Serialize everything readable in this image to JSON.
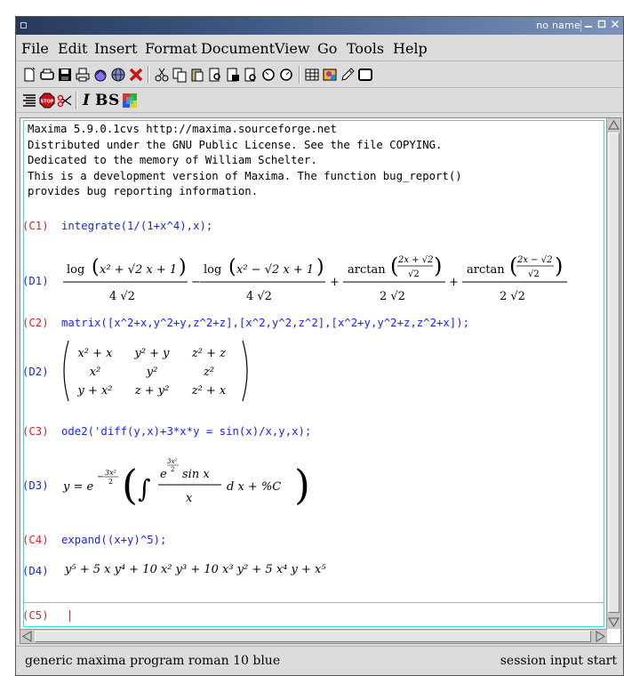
{
  "window": {
    "title": "no name",
    "controls": {
      "minimize": "‗",
      "maximize": "□",
      "close": "✕"
    }
  },
  "menu": [
    "File",
    "Edit",
    "Insert",
    "Format",
    "Document",
    "View",
    "Go",
    "Tools",
    "Help"
  ],
  "toolbar_icons": [
    "new-file-icon",
    "print-preview-icon",
    "save-icon",
    "print-icon",
    "home-icon",
    "globe-icon",
    "stop-x-icon",
    "cut-icon",
    "copy-icon",
    "paste-icon",
    "find-icon",
    "replace-icon",
    "find-next-icon",
    "undo-icon",
    "redo-icon",
    "table-icon",
    "image-icon",
    "pencil-icon",
    "frame-icon"
  ],
  "format_toolbar": {
    "icons": [
      "paragraph-align-icon",
      "stop-sign-icon",
      "scissors-icon"
    ],
    "italic": "I",
    "bold": "B",
    "strike": "S",
    "color_icon": "color-palette-icon"
  },
  "session": {
    "banner": [
      "Maxima 5.9.0.1cvs http://maxima.sourceforge.net",
      "Distributed under the GNU Public License. See the file COPYING.",
      "Dedicated to the memory of William Schelter.",
      "This is a development version of Maxima. The function bug_report()",
      "provides bug reporting information."
    ],
    "cells": [
      {
        "in_label": "(C1)",
        "input": "integrate(1/(1+x^4),x);",
        "out_label": "(D1)"
      },
      {
        "in_label": "(C2)",
        "input": "matrix([x^2+x,y^2+y,z^2+z],[x^2,y^2,z^2],[x^2+y,y^2+z,z^2+x]);",
        "out_label": "(D2)"
      },
      {
        "in_label": "(C3)",
        "input": "ode2('diff(y,x)+3*x*y = sin(x)/x,y,x);",
        "out_label": "(D3)"
      },
      {
        "in_label": "(C4)",
        "input": "expand((x+y)^5);",
        "out_label": "(D4)"
      }
    ],
    "prompt": "(C5)"
  },
  "math": {
    "d1": {
      "t1_log": "log",
      "t1_inner": "x² + √2 x + 1",
      "t1_den": "4 √2",
      "t2_log": "log",
      "t2_inner": "x² − √2 x + 1",
      "t2_den": "4 √2",
      "t3_fn": "arctan",
      "t3_num": "2x + √2",
      "t3_den_in": "√2",
      "t3_den": "2 √2",
      "t4_fn": "arctan",
      "t4_num": "2x − √2",
      "t4_den_in": "√2",
      "t4_den": "2 √2"
    },
    "d2": {
      "rows": [
        [
          "x² + x",
          "y² + y",
          "z² + z"
        ],
        [
          "x²",
          "y²",
          "z²"
        ],
        [
          "y + x²",
          "z + y²",
          "z² + x"
        ]
      ]
    },
    "d3": {
      "lhs": "y = e",
      "exp_num": "3x²",
      "exp_den": "2",
      "int_num_base": "e",
      "int_num_exp_num": "3x²",
      "int_num_exp_den": "2",
      "int_num_tail": "sin x",
      "int_den": "x",
      "int_tail": "d x + %C"
    },
    "d4": "y⁵ + 5 x y⁴ + 10 x² y³ + 10 x³ y² + 5 x⁴ y + x⁵"
  },
  "status": {
    "left": "generic maxima program roman 10 blue",
    "right": "session input start"
  },
  "colors": {
    "input_label": "#e02020",
    "output_label": "#1a22ff",
    "input_text": "#1a22ff",
    "cell_border": "#2ee3e3",
    "titlebar": "#3f5a86"
  }
}
